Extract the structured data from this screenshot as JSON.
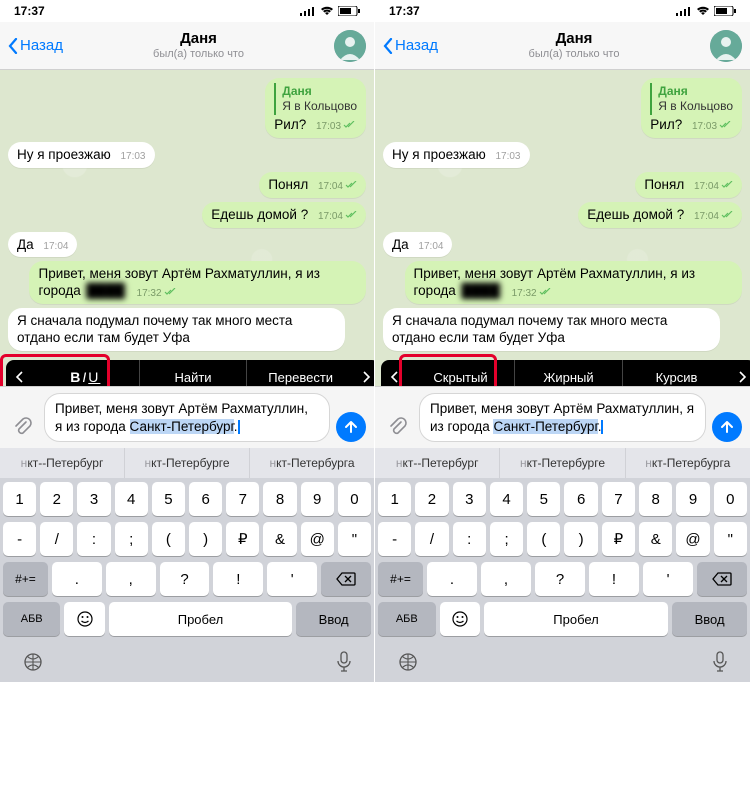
{
  "status": {
    "time": "17:37"
  },
  "header": {
    "back": "Назад",
    "title": "Даня",
    "subtitle": "был(а) только что"
  },
  "messages": {
    "reply_name": "Даня",
    "reply_text": "Я в Кольцово",
    "m1": "Рил?",
    "t1": "17:03",
    "m2": "Ну я проезжаю",
    "t2": "17:03",
    "m3": "Понял",
    "t3": "17:04",
    "m4": "Едешь домой ?",
    "t4": "17:04",
    "m5": "Да",
    "t5": "17:04",
    "m6a": "Привет, меня зовут Артём Рахматуллин, я из города ",
    "m6b_hidden": "████",
    "t6": "17:32",
    "m7a": "Я сначала подумал почему так много места отдано если там будет Уфа",
    "t7": ""
  },
  "context_menu": {
    "left": {
      "items": [
        "BIU",
        "Найти",
        "Перевести"
      ]
    },
    "right": {
      "items": [
        "Скрытый",
        "Жирный",
        "Курсив"
      ]
    }
  },
  "composer": {
    "prefix": "Привет, меня зовут Артём Рахматуллин, я из города ",
    "selected": "Санкт-Петербург",
    "suffix": "."
  },
  "suggestions": [
    "нкт--Петербург",
    "нкт-Петербурге",
    "нкт-Петербурга"
  ],
  "keyboard": {
    "row1": [
      "1",
      "2",
      "3",
      "4",
      "5",
      "6",
      "7",
      "8",
      "9",
      "0"
    ],
    "row2": [
      "-",
      "/",
      ":",
      ";",
      "(",
      ")",
      "₽",
      "&",
      "@",
      "\""
    ],
    "row3_sym": "#+=",
    "row3": [
      ".",
      ",",
      "?",
      "!",
      "'"
    ],
    "abv": "АБВ",
    "space": "Пробел",
    "enter": "Ввод"
  }
}
